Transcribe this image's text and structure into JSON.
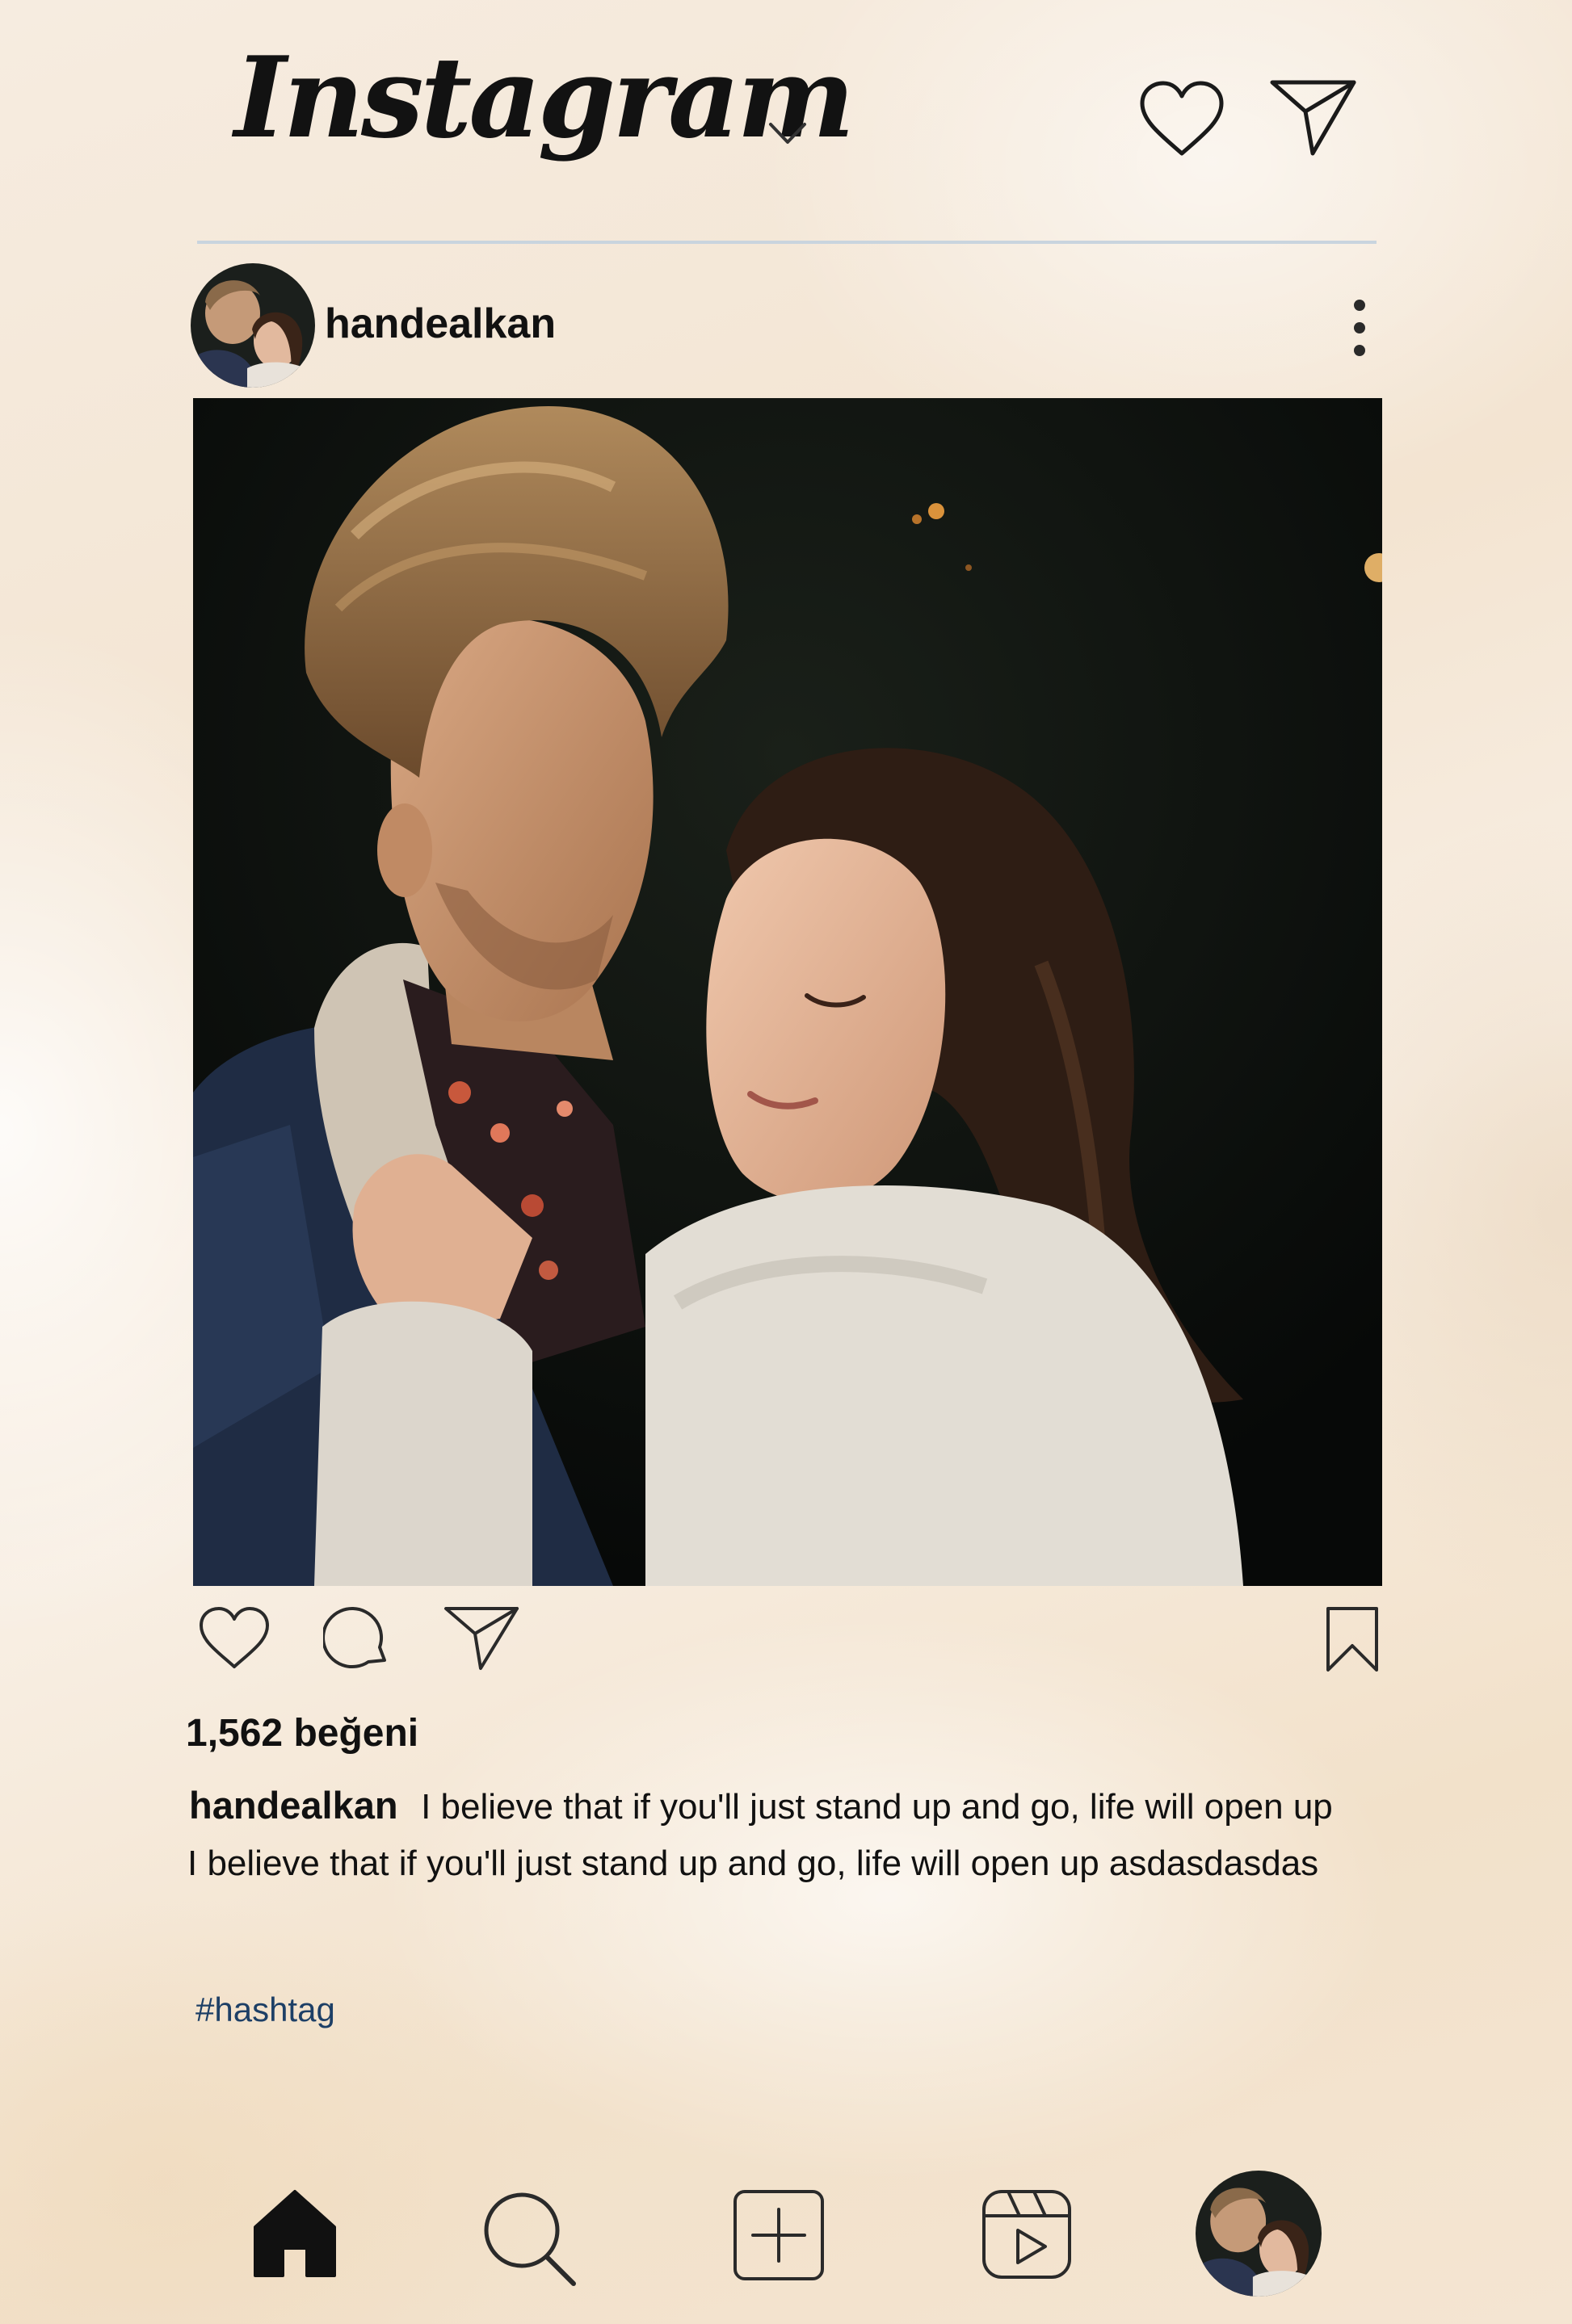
{
  "header": {
    "app_title": "Instagram",
    "icons": [
      "chevron-down-icon",
      "heart-icon",
      "send-icon"
    ]
  },
  "post": {
    "username": "handealkan",
    "likes": "1,562 beğeni",
    "caption": {
      "user": "handealkan",
      "line1": "I believe that if you'll just stand up and go, life will open up",
      "line2": "I believe that if you'll just stand up and go, life will open up asdasdasdas"
    },
    "hashtag": "#hashtag",
    "actions": [
      "heart-icon",
      "comment-icon",
      "send-icon",
      "bookmark-icon"
    ]
  },
  "bottom_nav": {
    "items": [
      "home-icon",
      "search-icon",
      "create-icon",
      "reels-icon",
      "profile-avatar"
    ]
  },
  "colors": {
    "background": "#f5e8d8",
    "text": "#111111",
    "hashtag": "#1d3f66",
    "divider": "#c9d4de"
  }
}
